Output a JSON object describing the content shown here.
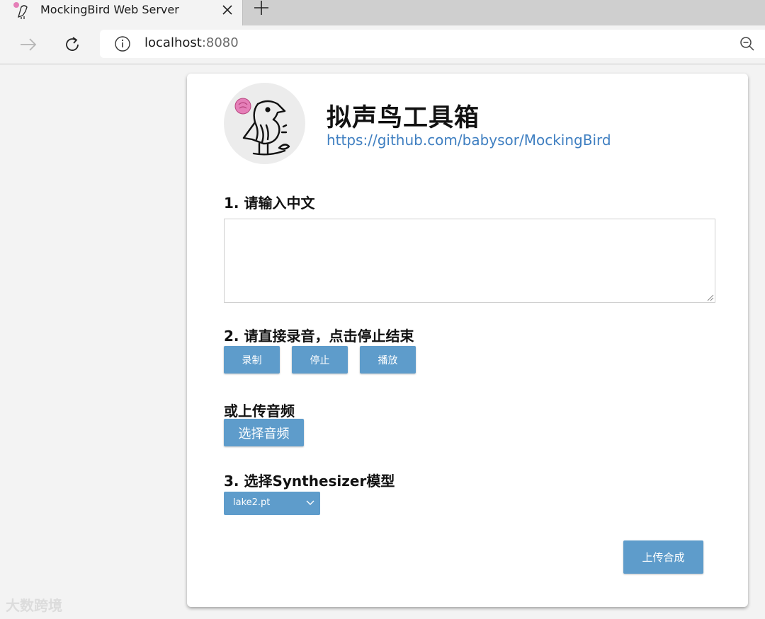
{
  "browser": {
    "tab_title": "MockingBird Web Server",
    "url_host": "localhost",
    "url_port": ":8080"
  },
  "page": {
    "title": "拟声鸟工具箱",
    "link": "https://github.com/babysor/MockingBird",
    "step1_label": "1. 请输入中文",
    "text_input_value": "",
    "step2_label": "2. 请直接录音，点击停止结束",
    "record_button": "录制",
    "stop_button": "停止",
    "play_button": "播放",
    "upload_label": "或上传音频",
    "choose_audio_button": "选择音频",
    "step3_label": "3. 选择Synthesizer模型",
    "model_selected": "lake2.pt",
    "submit_button": "上传合成"
  },
  "watermark": "大数跨境",
  "colors": {
    "button_blue": "#5e9ccb",
    "link_blue": "#3f7fc1"
  },
  "icons": [
    "mockingbird-logo-icon",
    "close-icon",
    "plus-icon",
    "forward-arrow-icon",
    "refresh-icon",
    "info-icon",
    "zoom-icon",
    "chevron-down-icon",
    "resize-grip-icon"
  ]
}
